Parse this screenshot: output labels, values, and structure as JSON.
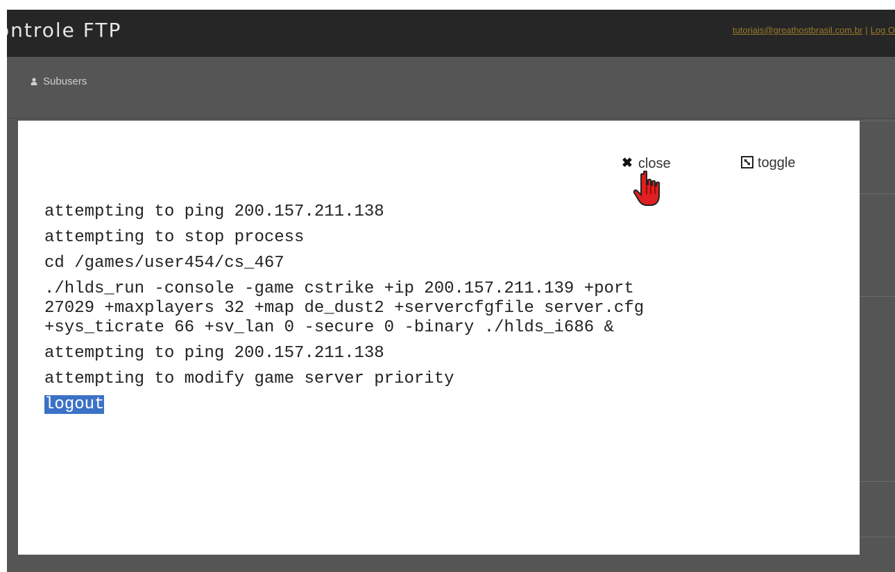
{
  "header": {
    "brand": "ontrole FTP",
    "user_email": "tutoriais@greathostbrasil.com.br",
    "separator": "|",
    "logout_link": "Log O"
  },
  "nav": {
    "subusers_label": "Subusers",
    "subusers_icon": "person-icon"
  },
  "modal": {
    "close_label": "close",
    "toggle_label": "toggle",
    "close_icon": "close-icon",
    "toggle_icon": "toggle-icon",
    "console_lines": [
      "attempting to ping 200.157.211.138",
      "attempting to stop process",
      "cd /games/user454/cs_467"
    ],
    "command_lines": [
      "./hlds_run -console -game cstrike +ip 200.157.211.139 +port",
      "27029 +maxplayers 32 +map de_dust2 +servercfgfile server.cfg",
      "+sys_ticrate 66 +sv_lan 0 -secure 0 -binary ./hlds_i686 &"
    ],
    "after_lines": [
      "attempting to ping 200.157.211.138",
      "attempting to modify game server priority"
    ],
    "selected_line": "logout"
  },
  "colors": {
    "header_bg": "#262626",
    "overlay_bg": "#555555",
    "link_color": "#9a7a2a",
    "selection_bg": "#3b72c6"
  }
}
